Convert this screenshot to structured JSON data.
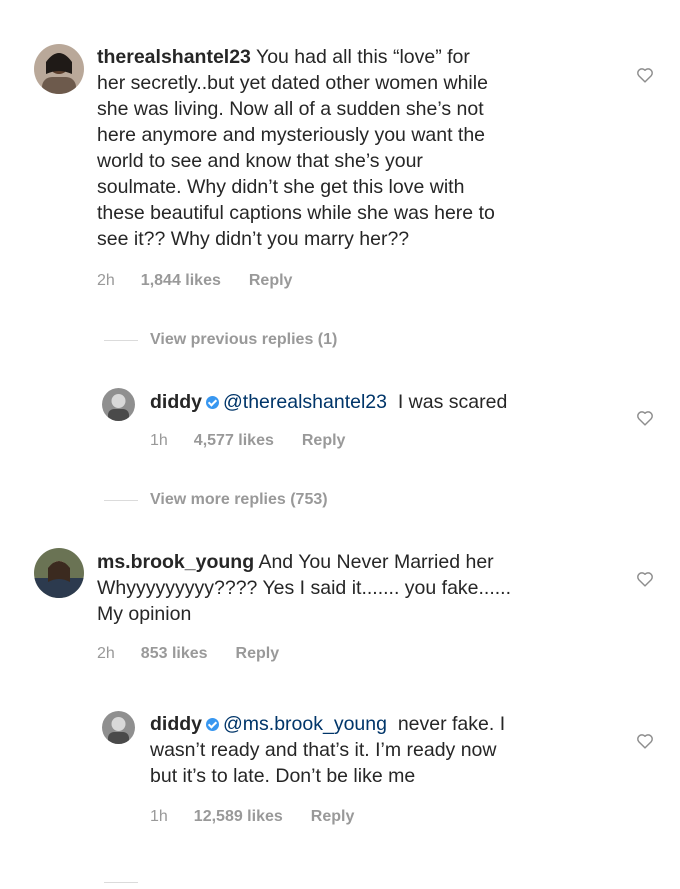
{
  "comments": [
    {
      "username": "therealshantel23",
      "text_lines": [
        "You had all this “love” for",
        "her secretly..but yet dated other women while",
        "she was living. Now all of a sudden she’s not",
        "here anymore and mysteriously you want the",
        "world to see and know that she’s your",
        "soulmate. Why didn’t she get this love with",
        "these beautiful captions while she was here to",
        "see it?? Why didn’t you marry her??"
      ],
      "time": "2h",
      "likes": "1,844 likes",
      "reply": "Reply",
      "view_previous": "View previous replies (1)",
      "replies": [
        {
          "username": "diddy",
          "mention": "@therealshantel23",
          "text_lines": [
            "I was scared"
          ],
          "time": "1h",
          "likes": "4,577 likes",
          "reply": "Reply"
        }
      ],
      "view_more": "View more replies (753)"
    },
    {
      "username": "ms.brook_young",
      "text_lines": [
        "And You Never Married her",
        "Whyyyyyyyyy???? Yes I said it....... you fake......",
        "My opinion"
      ],
      "time": "2h",
      "likes": "853 likes",
      "reply": "Reply",
      "replies": [
        {
          "username": "diddy",
          "mention": "@ms.brook_young",
          "text_lines": [
            "never fake. I",
            "wasn’t ready and that’s it.  I’m ready now",
            "but it’s to late.  Don’t be like me"
          ],
          "time": "1h",
          "likes": "12,589 likes",
          "reply": "Reply"
        }
      ]
    }
  ],
  "icons": {
    "like": "heart-outline-icon",
    "verified": "verified-badge-icon"
  },
  "colors": {
    "text": "#262626",
    "meta": "#999999",
    "verified": "#3897f0",
    "mention": "#003569"
  }
}
